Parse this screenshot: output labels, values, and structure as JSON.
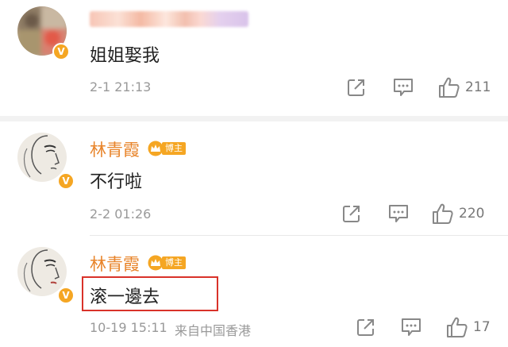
{
  "comments": [
    {
      "user_name": "",
      "text": "姐姐娶我",
      "time": "2-1 21:13",
      "like_count": "211",
      "avatar_icon": "blurred-avatar",
      "verified": true
    },
    {
      "user_name": "林青霞",
      "badge": "博主",
      "text": "不行啦",
      "time": "2-2 01:26",
      "like_count": "220",
      "avatar_icon": "sketch-portrait-avatar",
      "verified": true
    },
    {
      "user_name": "林青霞",
      "badge": "博主",
      "text": "滚一邊去",
      "time": "10-19 15:11",
      "source": "来自中国香港",
      "like_count": "17",
      "avatar_icon": "sketch-portrait-avatar",
      "verified": true
    }
  ],
  "colors": {
    "name": "#e8842a",
    "badge": "#f5a623",
    "highlight": "#d9322a",
    "meta": "#999999"
  },
  "icons": {
    "repost": "share-icon",
    "comment": "comment-icon",
    "like": "thumbs-up-icon",
    "verified": "verified-v-icon",
    "crown": "crown-icon"
  }
}
